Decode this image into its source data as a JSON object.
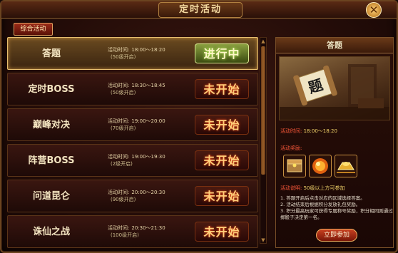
{
  "window": {
    "title": "定时活动",
    "close_symbol": "✕"
  },
  "tabs": [
    {
      "label": "综合活动"
    }
  ],
  "activities": [
    {
      "name": "答题",
      "time_label": "活动时间:",
      "time": "18:00～18:20",
      "level": "(50级开启)",
      "status": "进行中",
      "status_type": "ongoing",
      "active": true
    },
    {
      "name": "定时BOSS",
      "time_label": "活动时间:",
      "time": "18:30～18:45",
      "level": "(50级开启)",
      "status": "未开始",
      "status_type": "notstarted",
      "active": false
    },
    {
      "name": "巅峰对决",
      "time_label": "活动时间:",
      "time": "19:00～20:00",
      "level": "(70级开启)",
      "status": "未开始",
      "status_type": "notstarted",
      "active": false
    },
    {
      "name": "阵营BOSS",
      "time_label": "活动时间:",
      "time": "19:00～19:30",
      "level": "(2级开启)",
      "status": "未开始",
      "status_type": "notstarted",
      "active": false
    },
    {
      "name": "问道昆仑",
      "time_label": "活动时间:",
      "time": "20:00～20:30",
      "level": "(90级开启)",
      "status": "未开始",
      "status_type": "notstarted",
      "active": false
    },
    {
      "name": "诛仙之战",
      "time_label": "活动时间:",
      "time": "20:30～21:30",
      "level": "(100级开启)",
      "status": "未开始",
      "status_type": "notstarted",
      "active": false
    }
  ],
  "detail": {
    "title": "答题",
    "scroll_glyph": "题",
    "time_label": "活动时间:",
    "time": "18:00～18:20",
    "rewards_label": "活动奖励:",
    "rewards": [
      {
        "icon": "treasure-box-icon"
      },
      {
        "icon": "orb-icon"
      },
      {
        "icon": "gold-ingot-icon"
      }
    ],
    "desc_label": "活动说明:",
    "desc_value": "50级以上方可参加",
    "rules": [
      "1. 答题开启后点击对应的区域选择答案。",
      "2. 活动结束后根据积分发放礼包奖励。",
      "3. 积分最高玩家可获得专属称号奖励，积分相同则通过掷骰子决定第一名。"
    ],
    "join_label": "立即参加"
  }
}
